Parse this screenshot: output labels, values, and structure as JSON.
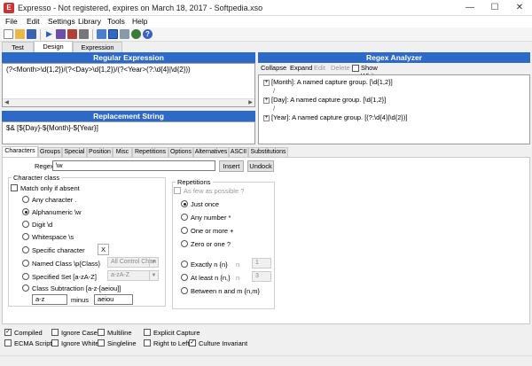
{
  "window": {
    "title": "Expresso - Not registered, expires on March 18, 2017 - Softpedia.xso",
    "icon_text": "E"
  },
  "menu": [
    "File",
    "Edit",
    "Settings",
    "Library",
    "Tools",
    "Help"
  ],
  "toolbar_icons": [
    "new-icon",
    "open-icon",
    "save-icon",
    "run-icon",
    "test-icon",
    "replace-icon",
    "clear-icon",
    "library-icon",
    "design-icon",
    "view-icon",
    "settings-icon",
    "help-icon"
  ],
  "top_tabs": [
    "Test Mode",
    "Design Mode",
    "Expression Library"
  ],
  "regex": {
    "header": "Regular Expression",
    "value": "(?<Month>\\d{1,2})/(?<Day>\\d{1,2})/(?<Year>(?:\\d{4}|\\d{2}))"
  },
  "replacement": {
    "header": "Replacement String",
    "value": "$& [${Day}-${Month}-${Year}]"
  },
  "analyzer": {
    "header": "Regex Analyzer",
    "toolbar": [
      "Collapse",
      "Expand",
      "Edit",
      "Delete"
    ],
    "show_whitespace": "Show Whitespace",
    "tree": [
      "[Month]: A named capture group. [\\d{1,2}]",
      "/",
      "[Day]: A named capture group. [\\d{1,2}]",
      "/",
      "[Year]: A named capture group. [(?:\\d{4}|\\d{2})]"
    ]
  },
  "builder_tabs": [
    "Characters",
    "Groups",
    "Special",
    "Position",
    "Misc",
    "Repetitions",
    "Options",
    "Alternatives",
    "ASCII",
    "Substitutions"
  ],
  "builder": {
    "regex_label": "Regex",
    "regex_value": "\\w",
    "insert": "Insert",
    "undock": "Undock",
    "char_class_title": "Character class",
    "match_only_if_absent": "Match only if absent",
    "options": [
      "Any character .",
      "Alphanumeric \\w",
      "Digit \\d",
      "Whitespace \\s",
      "Specific character",
      "Named Class \\p{Class}",
      "Specified Set [a-zA-Z]",
      "Class Subtraction [a-z-[aeiou]]"
    ],
    "specific_char_value": "X",
    "named_class_value": "All Control Chan",
    "specified_set_value": "a-zA-Z",
    "sub_from": "a-z",
    "minus": "minus",
    "sub_remove": "aeiou",
    "repetitions_title": "Repetitions",
    "few_as_possible": "As few as possible ?",
    "rep_options": [
      "Just once",
      "Any number *",
      "One or more +",
      "Zero or one ?",
      "Exactly n {n}",
      "At least n {n,}",
      "Between n and m {n,m}"
    ],
    "n_label": "n",
    "n1_value": "1",
    "n2_value": "3"
  },
  "options_checks": [
    {
      "label": "Compiled",
      "checked": true
    },
    {
      "label": "Ignore Case",
      "checked": false
    },
    {
      "label": "Multiline",
      "checked": false
    },
    {
      "label": "Explicit Capture",
      "checked": false
    },
    {
      "label": "ECMA Script",
      "checked": false
    },
    {
      "label": "Ignore White",
      "checked": false
    },
    {
      "label": "Singleline",
      "checked": false
    },
    {
      "label": "Right to Left",
      "checked": false
    },
    {
      "label": "Culture Invariant",
      "checked": true
    }
  ],
  "colors": {
    "header_blue": "#2d6ac8"
  }
}
